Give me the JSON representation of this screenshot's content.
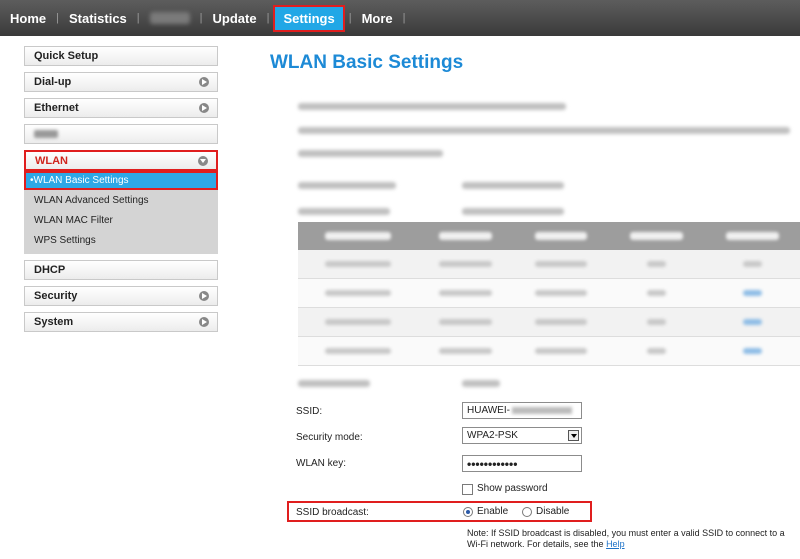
{
  "nav": {
    "items": [
      "Home",
      "Statistics",
      "Update",
      "Settings",
      "More"
    ]
  },
  "sidebar": {
    "quick_setup": "Quick Setup",
    "dialup": "Dial-up",
    "ethernet": "Ethernet",
    "wlan": "WLAN",
    "wlan_sub": [
      "•WLAN Basic Settings",
      "WLAN Advanced Settings",
      "WLAN MAC Filter",
      "WPS Settings"
    ],
    "dhcp": "DHCP",
    "security": "Security",
    "system": "System"
  },
  "main": {
    "title": "WLAN Basic Settings",
    "ssid_label": "SSID:",
    "ssid_value": "HUAWEI-",
    "security_mode_label": "Security mode:",
    "security_mode_value": "WPA2-PSK",
    "wlan_key_label": "WLAN key:",
    "wlan_key_value": "••••••••••••",
    "show_password": "Show password",
    "ssid_broadcast_label": "SSID broadcast:",
    "enable": "Enable",
    "disable": "Disable",
    "note_text": "Note: If SSID broadcast is disabled, you must enter a valid SSID to connect to a Wi-Fi network. For details, see the",
    "help_link": "Help"
  },
  "colors": {
    "accent": "#21a7e6",
    "highlight_border": "#e01e1e",
    "title": "#1d8ad6"
  }
}
